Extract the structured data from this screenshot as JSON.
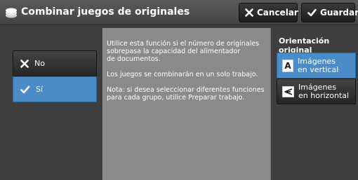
{
  "header": {
    "title": "Combinar juegos de originales",
    "cancel_label": "Cancelar",
    "save_label": "Guardar"
  },
  "options": [
    {
      "label": "No",
      "icon": "x-icon",
      "selected": false
    },
    {
      "label": "Sí",
      "icon": "checkmark-icon",
      "selected": true
    }
  ],
  "description": "Utilice esta función si el número de originales\nsobrepasa la capacidad del alimentador\nde documentos.\n\nLos juegos se combinarán en un solo trabajo.\n\nNota: si desea seleccionar diferentes funciones\npara cada grupo, utilice Preparar trabajo.",
  "orientation": {
    "label": "Orientación original",
    "options": [
      {
        "label": "Imágenes\nen vertical",
        "icon_letter": "A",
        "selected": true
      },
      {
        "label": "Imágenes\nen horizontal",
        "icon_letter": "A",
        "selected": false
      }
    ]
  },
  "colors": {
    "selected": "#4a8cc8",
    "panel": "#8a8a8a",
    "background": "#3e3e3e"
  }
}
